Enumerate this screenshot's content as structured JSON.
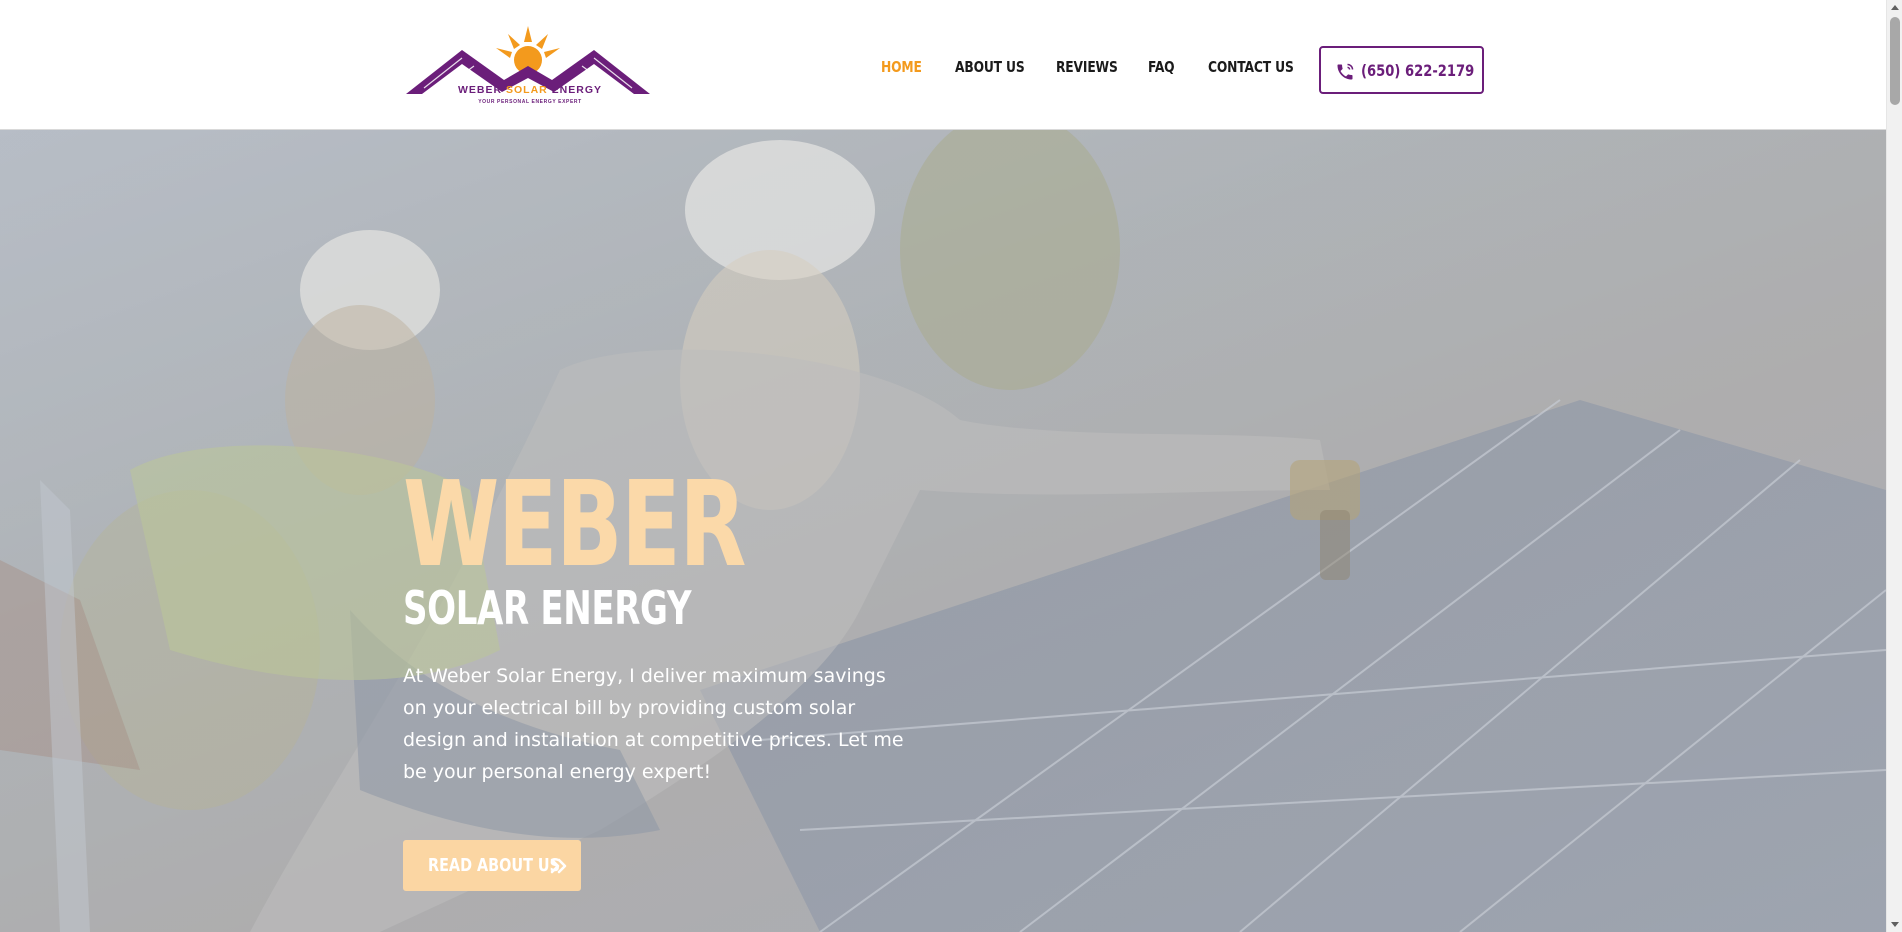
{
  "header": {
    "logo": {
      "name": "WEBER",
      "name_accent": "SOLAR",
      "name_tail": "ENERGY",
      "tagline": "YOUR PERSONAL ENERGY EXPERT"
    },
    "nav": [
      {
        "label": "HOME",
        "active": true
      },
      {
        "label": "ABOUT US",
        "active": false
      },
      {
        "label": "REVIEWS",
        "active": false
      },
      {
        "label": "FAQ",
        "active": false
      },
      {
        "label": "CONTACT US",
        "active": false
      }
    ],
    "phone": {
      "label": "(650) 622-2179",
      "icon": "phone-icon"
    }
  },
  "hero": {
    "title": "WEBER",
    "subtitle": "SOLAR ENERGY",
    "description": "At Weber Solar Energy, I deliver maximum savings on your electrical bill by providing custom solar design and installation at competitive prices. Let me be your personal energy expert!",
    "button": {
      "label": "READ ABOUT US",
      "icon": "double-chevron-right-icon"
    }
  },
  "colors": {
    "brand_purple": "#6b1e7a",
    "brand_orange": "#f39a1d",
    "hero_title": "#fbd9a9",
    "hero_button": "#fbd6a3"
  }
}
